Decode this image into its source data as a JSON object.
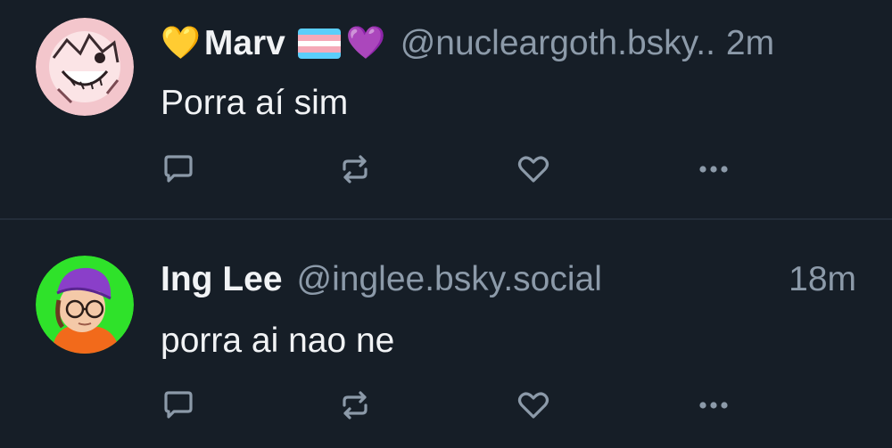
{
  "colors": {
    "background": "#161e27",
    "divider": "#232d39",
    "text_primary": "#f1f3f5",
    "text_secondary": "#8c9aa9",
    "icon": "#8c9aa9"
  },
  "posts": [
    {
      "avatar": "avatar-sketch-icon",
      "name_prefix_emoji": "💛",
      "display_name": "Marv",
      "name_suffix_flag": "transgender-flag-icon",
      "name_suffix_emoji": "💜",
      "handle": "@nucleargoth.bsky..",
      "time": "2m",
      "text": "Porra aí sim",
      "actions": [
        "reply-icon",
        "repost-icon",
        "like-icon",
        "more-icon"
      ]
    },
    {
      "avatar": "avatar-illustration-icon",
      "display_name": "Ing Lee",
      "handle": "@inglee.bsky.social",
      "time": "18m",
      "text": "porra ai nao ne",
      "actions": [
        "reply-icon",
        "repost-icon",
        "like-icon",
        "more-icon"
      ]
    }
  ]
}
